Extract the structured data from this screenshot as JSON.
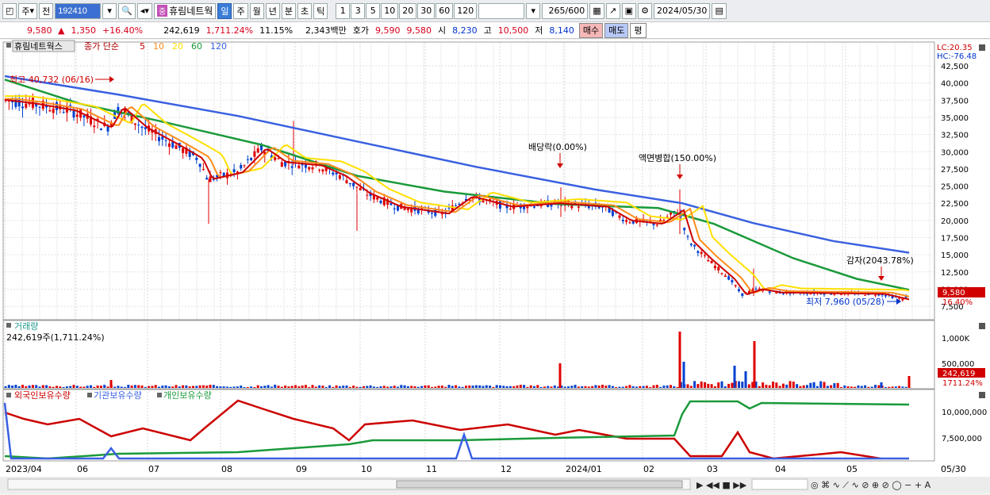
{
  "toolbar": {
    "market_type": "주",
    "prev_label": "전",
    "stock_code": "192410",
    "stock_name": "휴림네트웍",
    "name_badge": "중",
    "period_day": "일",
    "period_week": "주",
    "period_month": "월",
    "period_year": "년",
    "period_minute": "분",
    "period_second": "초",
    "period_tick": "틱",
    "intervals": [
      "1",
      "3",
      "5",
      "10",
      "20",
      "30",
      "60",
      "120"
    ],
    "count": "265",
    "count_max": "/600",
    "date": "2024/05/30"
  },
  "quote": {
    "price": "9,580",
    "change": "1,350",
    "change_pct": "+16.40%",
    "volume": "242,619",
    "volume_ratio": "1,711.24%",
    "turnover": "11.15%",
    "amount": "2,343백만",
    "bid_label": "호가",
    "ask_price": "9,590",
    "bid_price": "9,580",
    "open_label": "시",
    "open": "8,230",
    "high_label": "고",
    "high": "10,500",
    "low_label": "저",
    "low": "8,140",
    "buy_btn": "매수",
    "sell_btn": "매도",
    "eval_btn": "평"
  },
  "legend": {
    "stock": "휴림네트웍스",
    "type": "종가 단순",
    "ma": [
      "5",
      "10",
      "20",
      "60",
      "120"
    ],
    "ma_colors": [
      "#cc0000",
      "#ff8c1a",
      "#ffe000",
      "#1a9a3a",
      "#3a60e0"
    ]
  },
  "price_panel": {
    "lc": "LC:20.35",
    "hc": "HC:-76.48",
    "high_label": "최고 40,732 (06/16)",
    "low_label": "최저 7,960 (05/28)",
    "ann_dividend": "배당락(0.00%)",
    "ann_merge": "액면병합(150.00%)",
    "ann_reduce": "감자(2043.78%)",
    "current": "9,580",
    "current_pct": "16.40%",
    "y_labels": [
      "42,500",
      "40,000",
      "37,500",
      "35,000",
      "32,500",
      "30,000",
      "27,500",
      "25,000",
      "22,500",
      "20,000",
      "17,500",
      "15,000",
      "12,500",
      "10,000",
      "7,500"
    ]
  },
  "volume_panel": {
    "title": "거래량",
    "value_label": "242,619주(1,711.24%)",
    "y_label": "1,000K",
    "y_label2": "500,000",
    "current": "242,619",
    "current_pct": "1711.24%"
  },
  "holding_panel": {
    "foreign": "외국인보유수량",
    "inst": "기관보유수량",
    "indiv": "개인보유수량",
    "y_labels": [
      "10,000,000",
      "7,500,000"
    ]
  },
  "xaxis": {
    "labels": [
      "2023/04",
      "06",
      "07",
      "08",
      "09",
      "10",
      "11",
      "12",
      "2024/01",
      "02",
      "03",
      "04",
      "05"
    ],
    "end": "05/30"
  },
  "chart_data": {
    "type": "candlestick",
    "title": "",
    "y_range": [
      7500,
      42500
    ],
    "moving_averages": [
      "5",
      "10",
      "20",
      "60",
      "120"
    ]
  }
}
